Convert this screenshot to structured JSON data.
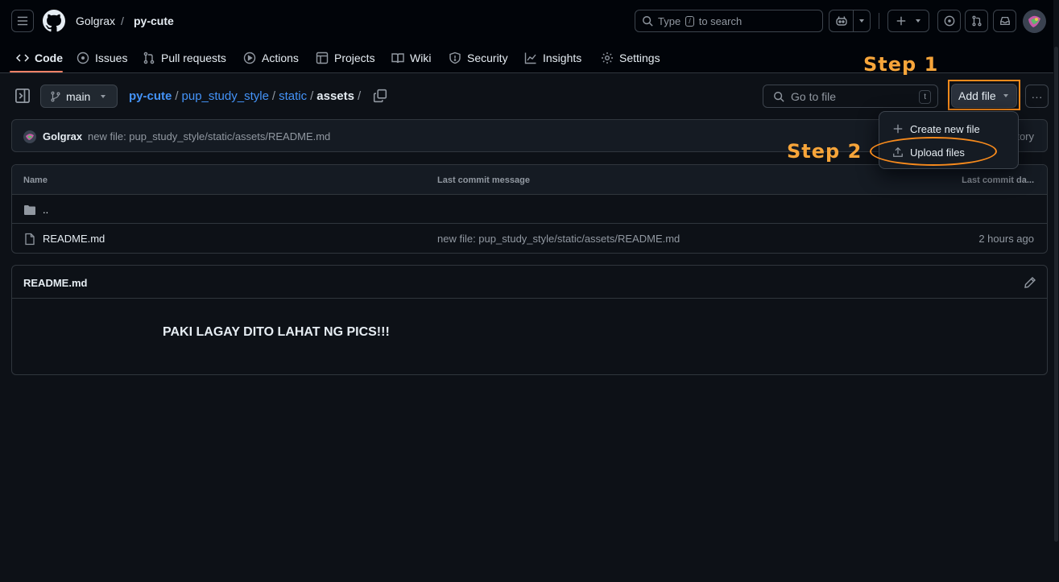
{
  "header": {
    "owner": "Golgrax",
    "separator": "/",
    "repo": "py-cute",
    "search_text": "Type",
    "search_kbd": "/",
    "search_suffix": "to search"
  },
  "tabs": [
    {
      "label": "Code",
      "icon": "code-icon"
    },
    {
      "label": "Issues",
      "icon": "issue-icon"
    },
    {
      "label": "Pull requests",
      "icon": "pull-request-icon"
    },
    {
      "label": "Actions",
      "icon": "play-icon"
    },
    {
      "label": "Projects",
      "icon": "table-icon"
    },
    {
      "label": "Wiki",
      "icon": "book-icon"
    },
    {
      "label": "Security",
      "icon": "shield-icon"
    },
    {
      "label": "Insights",
      "icon": "graph-icon"
    },
    {
      "label": "Settings",
      "icon": "gear-icon"
    }
  ],
  "toolbar": {
    "branch": "main",
    "path": {
      "root": "py-cute",
      "seg1": "pup_study_style",
      "seg2": "static",
      "current": "assets",
      "sep": "/"
    },
    "goto_placeholder": "Go to file",
    "goto_key": "t",
    "add_file": "Add file",
    "more": "···"
  },
  "commit": {
    "author": "Golgrax",
    "message": "new file: pup_study_style/static/assets/README.md",
    "history": "tory"
  },
  "dropdown": {
    "create": "Create new file",
    "upload": "Upload files"
  },
  "annotations": {
    "step1": "Step 1",
    "step2": "Step 2",
    "color": "#f7a53a"
  },
  "files": {
    "headers": {
      "name": "Name",
      "message": "Last commit message",
      "date": "Last commit da..."
    },
    "parent": "..",
    "rows": [
      {
        "name": "README.md",
        "message": "new file: pup_study_style/static/assets/README.md",
        "date": "2 hours ago"
      }
    ]
  },
  "readme": {
    "title": "README.md",
    "body": "PAKI LAGAY DITO LAHAT NG PICS!!!"
  }
}
